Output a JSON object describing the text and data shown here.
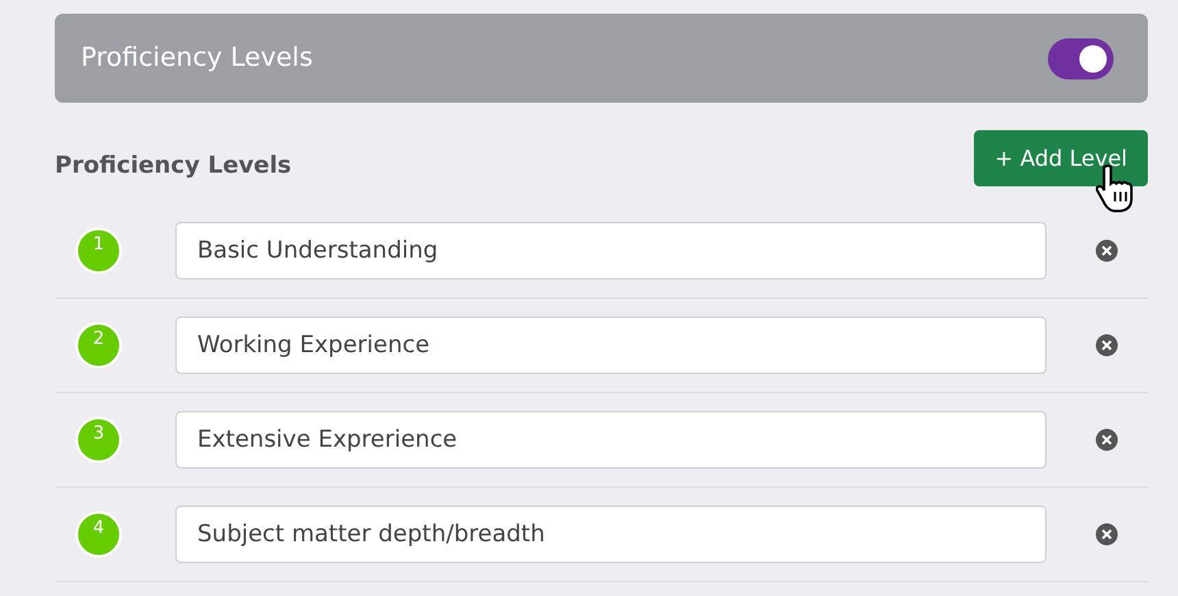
{
  "header": {
    "title": "Proficiency Levels",
    "toggle_on": true
  },
  "section": {
    "title": "Proficiency Levels",
    "add_button": "+ Add Level"
  },
  "levels": [
    {
      "number": "1",
      "value": "Basic Understanding"
    },
    {
      "number": "2",
      "value": "Working Experience"
    },
    {
      "number": "3",
      "value": "Extensive Exprerience"
    },
    {
      "number": "4",
      "value": "Subject matter depth/breadth"
    }
  ]
}
